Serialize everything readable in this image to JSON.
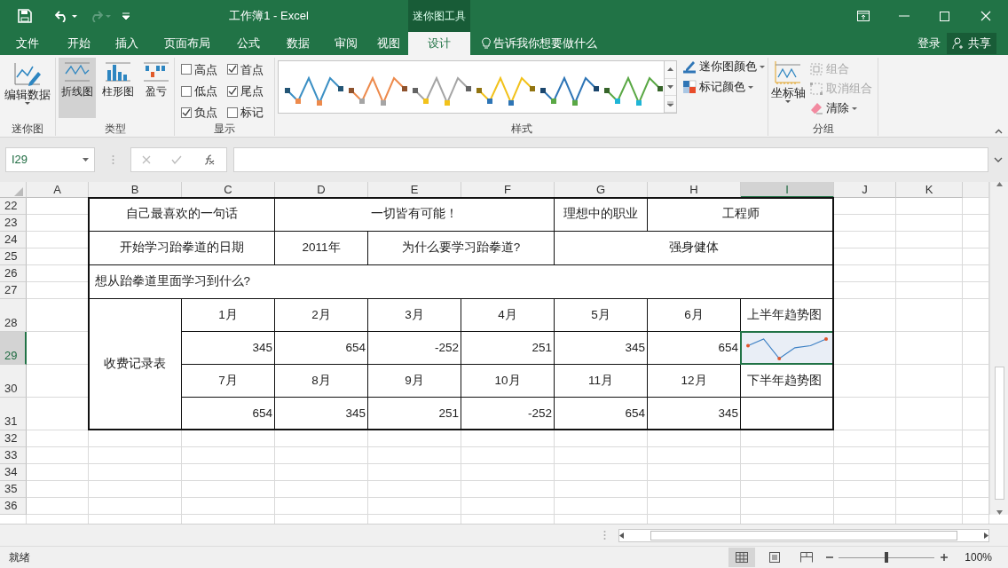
{
  "title_bar": {
    "title": "工作簿1 - Excel",
    "context_label": "迷你图工具"
  },
  "tabs": [
    {
      "label": "文件",
      "selected": false
    },
    {
      "label": "开始",
      "selected": false
    },
    {
      "label": "插入",
      "selected": false
    },
    {
      "label": "页面布局",
      "selected": false
    },
    {
      "label": "公式",
      "selected": false
    },
    {
      "label": "数据",
      "selected": false
    },
    {
      "label": "审阅",
      "selected": false
    },
    {
      "label": "视图",
      "selected": false
    },
    {
      "label": "设计",
      "selected": true
    }
  ],
  "tell_me": "告诉我你想要做什么",
  "sign_in": "登录",
  "share": "共享",
  "ribbon": {
    "sparkline_group": {
      "label": "迷你图",
      "button": "编辑数据"
    },
    "type_group": {
      "label": "类型",
      "buttons": [
        {
          "label": "折线图",
          "kind": "line",
          "selected": true
        },
        {
          "label": "柱形图",
          "kind": "column",
          "selected": false
        },
        {
          "label": "盈亏",
          "kind": "winloss",
          "selected": false
        }
      ]
    },
    "show_group": {
      "label": "显示",
      "checkboxes": [
        {
          "label": "高点",
          "checked": false
        },
        {
          "label": "首点",
          "checked": true
        },
        {
          "label": "低点",
          "checked": false
        },
        {
          "label": "尾点",
          "checked": true
        },
        {
          "label": "负点",
          "checked": true
        },
        {
          "label": "标记",
          "checked": false
        }
      ]
    },
    "style_group": {
      "label": "样式",
      "styles": [
        {
          "color": "#3b8fc4"
        },
        {
          "color": "#ed8a4c"
        },
        {
          "color": "#a5a5a5"
        },
        {
          "color": "#f2c21b"
        },
        {
          "color": "#2e75b6"
        },
        {
          "color": "#5aa845"
        }
      ],
      "buttons": [
        {
          "label": "迷你图颜色",
          "kind": "line_color"
        },
        {
          "label": "标记颜色",
          "kind": "marker_color"
        }
      ]
    },
    "group_group": {
      "label": "分组",
      "axis_button": "坐标轴",
      "buttons": [
        {
          "label": "组合",
          "kind": "group",
          "disabled": true
        },
        {
          "label": "取消组合",
          "kind": "ungroup",
          "disabled": true
        },
        {
          "label": "清除",
          "kind": "clear",
          "disabled": false
        }
      ]
    }
  },
  "formula_bar": {
    "name_box": "I29"
  },
  "sheet": {
    "columns": [
      {
        "label": "A",
        "selected": false
      },
      {
        "label": "B",
        "selected": false
      },
      {
        "label": "C",
        "selected": false
      },
      {
        "label": "D",
        "selected": false
      },
      {
        "label": "E",
        "selected": false
      },
      {
        "label": "F",
        "selected": false
      },
      {
        "label": "G",
        "selected": false
      },
      {
        "label": "H",
        "selected": false
      },
      {
        "label": "I",
        "selected": true
      },
      {
        "label": "J",
        "selected": false
      },
      {
        "label": "K",
        "selected": false
      }
    ],
    "rows": [
      {
        "label": "22",
        "tall": false,
        "selected": false
      },
      {
        "label": "23",
        "tall": false,
        "selected": false
      },
      {
        "label": "24",
        "tall": false,
        "selected": false
      },
      {
        "label": "25",
        "tall": false,
        "selected": false
      },
      {
        "label": "26",
        "tall": false,
        "selected": false
      },
      {
        "label": "27",
        "tall": false,
        "selected": false
      },
      {
        "label": "28",
        "tall": true,
        "selected": false
      },
      {
        "label": "29",
        "tall": true,
        "selected": true
      },
      {
        "label": "30",
        "tall": true,
        "selected": false
      },
      {
        "label": "31",
        "tall": true,
        "selected": false
      },
      {
        "label": "32",
        "tall": false,
        "selected": false
      },
      {
        "label": "33",
        "tall": false,
        "selected": false
      },
      {
        "label": "34",
        "tall": false,
        "selected": false
      },
      {
        "label": "35",
        "tall": false,
        "selected": false
      },
      {
        "label": "36",
        "tall": false,
        "selected": false
      }
    ],
    "cells": [
      {
        "text": "自己最喜欢的一句话",
        "kind": "text",
        "selected": false
      },
      {
        "text": "一切皆有可能！",
        "kind": "text",
        "selected": false
      },
      {
        "text": "理想中的职业",
        "kind": "text",
        "selected": false
      },
      {
        "text": "工程师",
        "kind": "text",
        "selected": false
      },
      {
        "text": "开始学习跆拳道的日期",
        "kind": "text",
        "selected": false
      },
      {
        "text": "2011年",
        "kind": "text",
        "selected": false
      },
      {
        "text": "为什么要学习跆拳道?",
        "kind": "text",
        "selected": false
      },
      {
        "text": "强身健体",
        "kind": "text",
        "selected": false
      },
      {
        "text": "想从跆拳道里面学习到什么?",
        "kind": "note",
        "selected": false
      },
      {
        "text": "收费记录表",
        "kind": "text",
        "selected": false
      },
      {
        "text": "1月",
        "kind": "text",
        "selected": false
      },
      {
        "text": "2月",
        "kind": "text",
        "selected": false
      },
      {
        "text": "3月",
        "kind": "text",
        "selected": false
      },
      {
        "text": "4月",
        "kind": "text",
        "selected": false
      },
      {
        "text": "5月",
        "kind": "text",
        "selected": false
      },
      {
        "text": "6月",
        "kind": "text",
        "selected": false
      },
      {
        "text": "上半年趋势图",
        "kind": "note",
        "selected": false
      },
      {
        "text": "345",
        "kind": "number",
        "selected": false
      },
      {
        "text": "654",
        "kind": "number",
        "selected": false
      },
      {
        "text": "-252",
        "kind": "number",
        "selected": false
      },
      {
        "text": "251",
        "kind": "number",
        "selected": false
      },
      {
        "text": "345",
        "kind": "number",
        "selected": false
      },
      {
        "text": "654",
        "kind": "number",
        "selected": false
      },
      {
        "kind": "sparkline",
        "selected": true
      },
      {
        "text": "7月",
        "kind": "text",
        "selected": false
      },
      {
        "text": "8月",
        "kind": "text",
        "selected": false
      },
      {
        "text": "9月",
        "kind": "text",
        "selected": false
      },
      {
        "text": "10月",
        "kind": "text",
        "selected": false
      },
      {
        "text": "11月",
        "kind": "text",
        "selected": false
      },
      {
        "text": "12月",
        "kind": "text",
        "selected": false
      },
      {
        "text": "下半年趋势图",
        "kind": "note",
        "selected": false
      },
      {
        "text": "654",
        "kind": "number",
        "selected": false
      },
      {
        "text": "345",
        "kind": "number",
        "selected": false
      },
      {
        "text": "251",
        "kind": "number",
        "selected": false
      },
      {
        "text": "-252",
        "kind": "number",
        "selected": false
      },
      {
        "text": "654",
        "kind": "number",
        "selected": false
      },
      {
        "text": "345",
        "kind": "number",
        "selected": false
      }
    ]
  },
  "status_bar": {
    "status": "就绪",
    "views": [
      {
        "kind": "normal",
        "selected": true
      },
      {
        "kind": "page_layout",
        "selected": false
      },
      {
        "kind": "page_break",
        "selected": false
      }
    ],
    "zoom": {
      "level": 0.5,
      "reading": "100%"
    }
  }
}
